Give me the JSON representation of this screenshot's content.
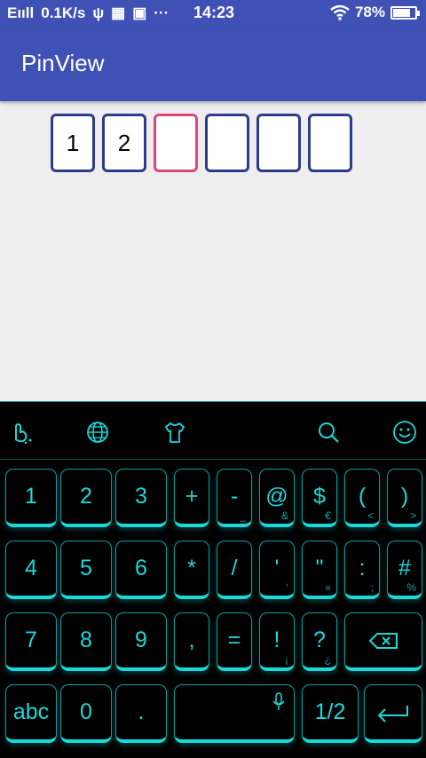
{
  "status_bar": {
    "signal_text": "Eııll",
    "speed": "0.1K/s",
    "time": "14:23",
    "battery": "78%",
    "battery_level": 0.78
  },
  "app": {
    "title": "PinView"
  },
  "pin_view": {
    "digits": [
      "1",
      "2",
      "",
      "",
      "",
      ""
    ],
    "active_index": 2,
    "colors": {
      "border": "#2e3a8c",
      "active_border": "#e0457b"
    }
  },
  "keyboard": {
    "toolbar_icons": [
      "swipe-hand-icon",
      "globe-icon",
      "theme-shirt-icon",
      "search-icon",
      "emoji-icon"
    ],
    "accent_color": "#19d9d9",
    "rows": [
      [
        {
          "label": "1"
        },
        {
          "label": "2"
        },
        {
          "label": "3"
        },
        {
          "label": "+"
        },
        {
          "label": "-",
          "sub": "_"
        },
        {
          "label": "@",
          "sub": "&"
        },
        {
          "label": "$",
          "sub": "€"
        },
        {
          "label": "(",
          "sub": "<"
        },
        {
          "label": ")",
          "sub": ">"
        }
      ],
      [
        {
          "label": "4"
        },
        {
          "label": "5"
        },
        {
          "label": "6"
        },
        {
          "label": "*"
        },
        {
          "label": "/"
        },
        {
          "label": "'",
          "sub": "‘"
        },
        {
          "label": "\"",
          "sub": "«"
        },
        {
          "label": ":",
          "sub": ";"
        },
        {
          "label": "#",
          "sub": "%"
        }
      ],
      [
        {
          "label": "7"
        },
        {
          "label": "8"
        },
        {
          "label": "9"
        },
        {
          "label": ","
        },
        {
          "label": "="
        },
        {
          "label": "!",
          "sub": "¡"
        },
        {
          "label": "?",
          "sub": "¿"
        }
      ],
      [
        {
          "label": "abc"
        },
        {
          "label": "0"
        },
        {
          "label": "."
        },
        {
          "label": "1/2"
        }
      ]
    ],
    "backspace_icon": "backspace-icon",
    "mic_icon": "microphone-icon",
    "enter_icon": "enter-icon"
  }
}
